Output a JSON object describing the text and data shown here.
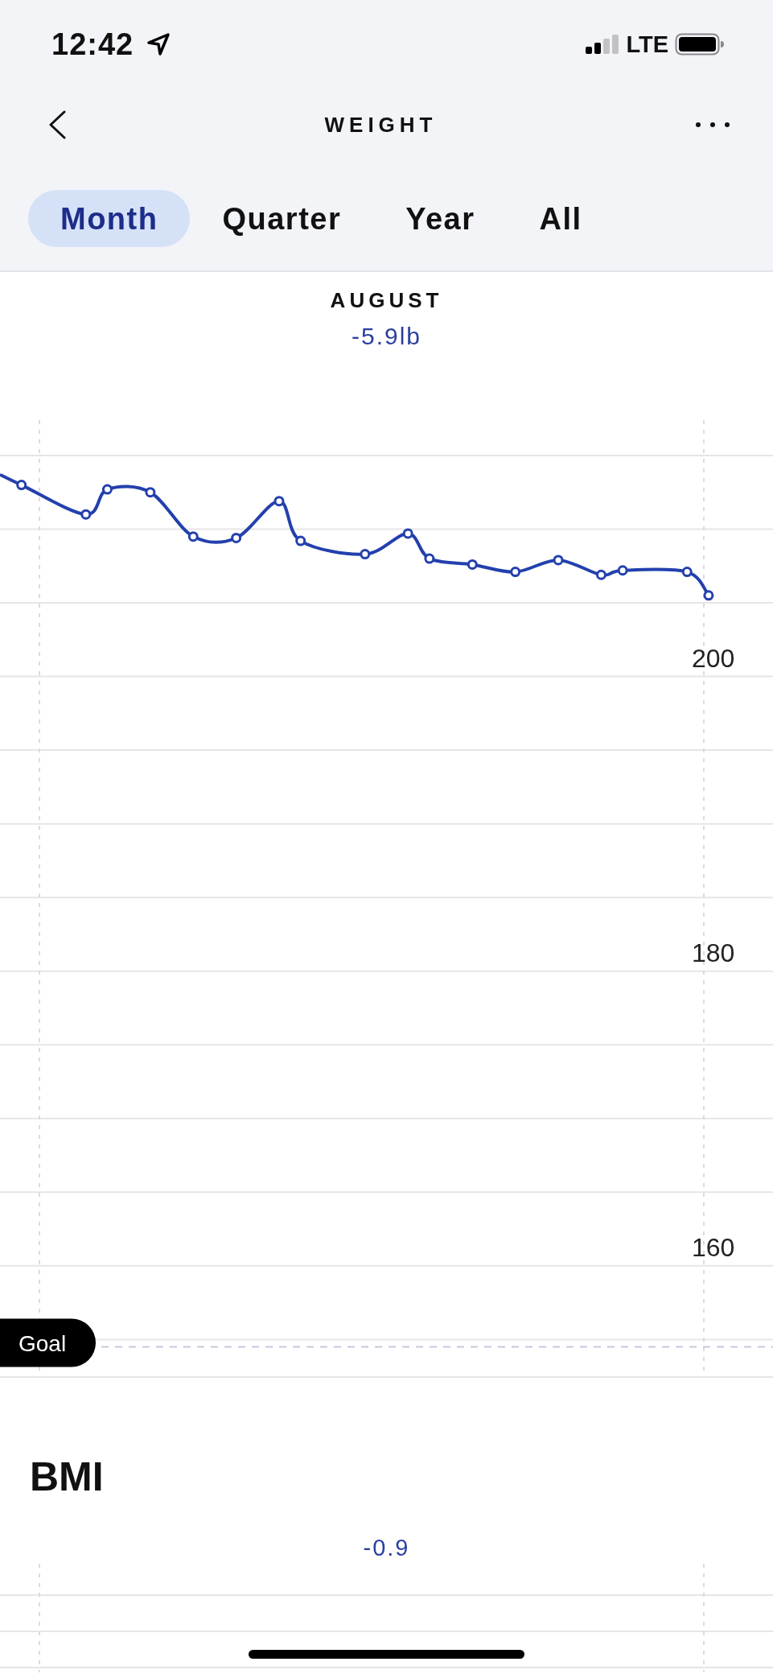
{
  "status_bar": {
    "time": "12:42",
    "network": "LTE"
  },
  "nav": {
    "title": "WEIGHT"
  },
  "tabs": [
    {
      "label": "Month",
      "selected": true
    },
    {
      "label": "Quarter",
      "selected": false
    },
    {
      "label": "Year",
      "selected": false
    },
    {
      "label": "All",
      "selected": false
    }
  ],
  "weight": {
    "period": "AUGUST",
    "change": "-5.9lb",
    "chart_data": {
      "type": "line",
      "categories": [
        null,
        null,
        null,
        null,
        null,
        null,
        null,
        null,
        null,
        null,
        null,
        null,
        null,
        null,
        null,
        null,
        null,
        null,
        null,
        null,
        null,
        null,
        null,
        null,
        null,
        null,
        null,
        null,
        null,
        null,
        null,
        null,
        null,
        null,
        null,
        null,
        null
      ],
      "values": [
        213.7,
        213.0,
        null,
        null,
        211.0,
        212.7,
        null,
        212.5,
        null,
        209.5,
        null,
        209.4,
        null,
        211.9,
        209.2,
        null,
        null,
        208.3,
        null,
        209.7,
        208.0,
        null,
        207.6,
        null,
        207.1,
        null,
        207.9,
        null,
        206.9,
        207.2,
        null,
        null,
        207.1,
        205.5,
        null,
        null,
        null
      ],
      "marker": true,
      "ylim": [
        152.4,
        217.4
      ],
      "yticks": [
        {
          "value": 200,
          "label": "200"
        },
        {
          "value": 180,
          "label": "180"
        },
        {
          "value": 160,
          "label": "160"
        }
      ],
      "grid": true,
      "ref_lines": [
        {
          "axis": "y",
          "value": 154.5,
          "label": "Goal"
        }
      ]
    }
  },
  "bmi": {
    "title": "BMI",
    "change": "-0.9"
  }
}
